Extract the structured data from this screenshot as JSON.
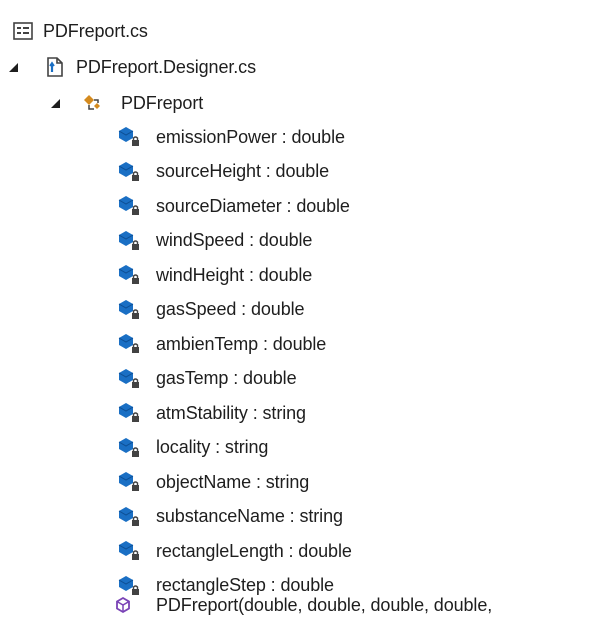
{
  "tree": {
    "file": {
      "label": "PDFreport.cs",
      "icon": "cs-file-icon"
    },
    "designer": {
      "label": "PDFreport.Designer.cs",
      "icon": "designer-file-icon",
      "expanded": true
    },
    "class": {
      "label": "PDFreport",
      "icon": "class-icon",
      "expanded": true
    },
    "fields": [
      {
        "label": "emissionPower : double",
        "icon": "private-field-icon"
      },
      {
        "label": "sourceHeight : double",
        "icon": "private-field-icon"
      },
      {
        "label": "sourceDiameter : double",
        "icon": "private-field-icon"
      },
      {
        "label": "windSpeed : double",
        "icon": "private-field-icon"
      },
      {
        "label": "windHeight : double",
        "icon": "private-field-icon"
      },
      {
        "label": "gasSpeed : double",
        "icon": "private-field-icon"
      },
      {
        "label": "ambienTemp : double",
        "icon": "private-field-icon"
      },
      {
        "label": "gasTemp : double",
        "icon": "private-field-icon"
      },
      {
        "label": "atmStability : string",
        "icon": "private-field-icon"
      },
      {
        "label": "locality : string",
        "icon": "private-field-icon"
      },
      {
        "label": "objectName : string",
        "icon": "private-field-icon"
      },
      {
        "label": "substanceName : string",
        "icon": "private-field-icon"
      },
      {
        "label": "rectangleLength : double",
        "icon": "private-field-icon"
      },
      {
        "label": "rectangleStep : double",
        "icon": "private-field-icon"
      }
    ],
    "method": {
      "label": "PDFreport(double, double, double, double,",
      "icon": "method-icon"
    }
  },
  "colors": {
    "field_blue": "#1a6fc4",
    "lock_dark": "#424242",
    "class_orange": "#d48a1e",
    "method_purple": "#7a43b6"
  }
}
